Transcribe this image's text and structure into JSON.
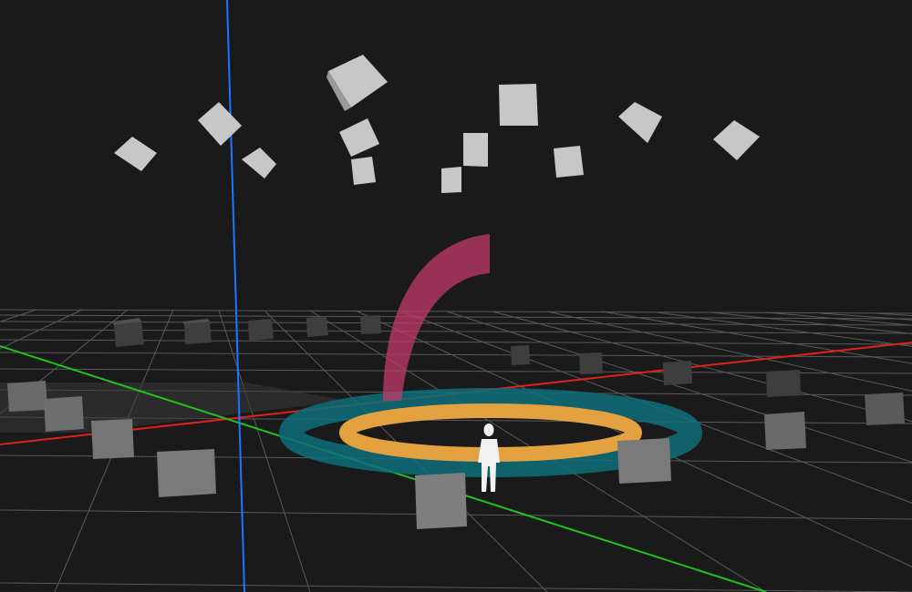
{
  "viewport": {
    "background": "#1a1a1a",
    "grid_color": "#5a5a5a",
    "axis_colors": {
      "x": "#e0201c",
      "y": "#22c022",
      "z": "#1a78ff"
    }
  },
  "objects": {
    "floating_cubes": {
      "count": 14,
      "color": "#c7c7c7"
    },
    "ground_cubes": {
      "count": 19,
      "color": "#7a7a7a"
    },
    "arc": {
      "color": "#c23a6a"
    },
    "rings": {
      "outer_color": "#0e6f7a",
      "inner_color": "#e3a23f"
    },
    "human_figure": {
      "color": "#f2f2f2"
    },
    "ground_plane_highlight": {
      "color": "#3a3a3a"
    }
  }
}
